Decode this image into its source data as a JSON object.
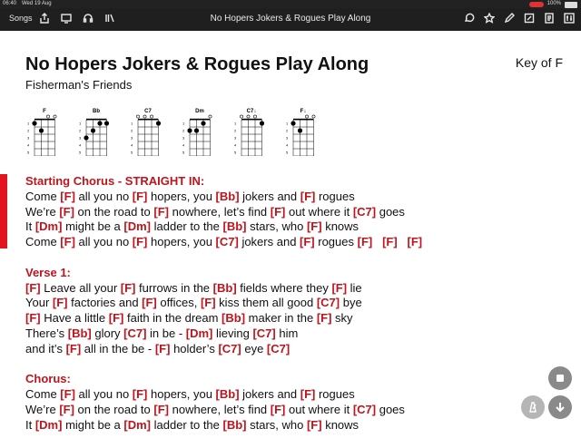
{
  "status_bar": {
    "time": "06:40",
    "date": "Wed 19 Aug",
    "battery": "100%"
  },
  "toolbar": {
    "songs_label": "Songs",
    "title": "No Hopers Jokers & Rogues Play Along"
  },
  "song": {
    "title": "No Hopers Jokers & Rogues Play Along",
    "artist": "Fisherman's Friends",
    "key": "Key of F"
  },
  "chord_diagrams": [
    {
      "name": "F",
      "markers": [
        "",
        "",
        "o",
        "o"
      ],
      "dots": [
        [
          1,
          0
        ],
        [
          2,
          1
        ]
      ]
    },
    {
      "name": "Bb",
      "markers": [
        "",
        "",
        "",
        ""
      ],
      "dots": [
        [
          1,
          2
        ],
        [
          1,
          3
        ],
        [
          2,
          1
        ],
        [
          3,
          0
        ]
      ]
    },
    {
      "name": "C7",
      "markers": [
        "o",
        "o",
        "o",
        ""
      ],
      "dots": [
        [
          1,
          3
        ]
      ]
    },
    {
      "name": "Dm",
      "markers": [
        "",
        "",
        "",
        "o"
      ],
      "dots": [
        [
          1,
          2
        ],
        [
          2,
          0
        ],
        [
          2,
          1
        ]
      ]
    },
    {
      "name": "C7↓",
      "markers": [
        "o",
        "o",
        "o",
        ""
      ],
      "dots": [
        [
          1,
          3
        ]
      ]
    },
    {
      "name": "F↓",
      "markers": [
        "",
        "",
        "o",
        "o"
      ],
      "dots": [
        [
          1,
          0
        ],
        [
          2,
          1
        ]
      ]
    }
  ],
  "sections": [
    {
      "title": "Starting Chorus - STRAIGHT IN:",
      "lines": [
        [
          [
            "",
            "Come "
          ],
          [
            "F",
            " all you no "
          ],
          [
            "F",
            " hopers, you "
          ],
          [
            "Bb",
            " jokers and "
          ],
          [
            "F",
            " rogues"
          ]
        ],
        [
          [
            "",
            "We’re "
          ],
          [
            "F",
            " on the road to "
          ],
          [
            "F",
            " nowhere, let’s find "
          ],
          [
            "F",
            " out where it "
          ],
          [
            "C7",
            " goes"
          ]
        ],
        [
          [
            "",
            "It "
          ],
          [
            "Dm",
            " might be a "
          ],
          [
            "Dm",
            " ladder to the "
          ],
          [
            "Bb",
            " stars, who "
          ],
          [
            "F",
            " knows"
          ]
        ],
        [
          [
            "",
            "Come "
          ],
          [
            "F",
            " all you no "
          ],
          [
            "F",
            " hopers, you "
          ],
          [
            "C7",
            " jokers and "
          ],
          [
            "F",
            " rogues "
          ],
          [
            "F",
            "   "
          ],
          [
            "F",
            "   "
          ],
          [
            "F",
            ""
          ]
        ]
      ]
    },
    {
      "title": "Verse 1:",
      "lines": [
        [
          [
            "F",
            " Leave all your "
          ],
          [
            "F",
            " furrows in the "
          ],
          [
            "Bb",
            " fields where they "
          ],
          [
            "F",
            " lie"
          ]
        ],
        [
          [
            "",
            "Your "
          ],
          [
            "F",
            " factories and "
          ],
          [
            "F",
            " offices, "
          ],
          [
            "F",
            " kiss them all good "
          ],
          [
            "C7",
            " bye"
          ]
        ],
        [
          [
            "F",
            " Have a little "
          ],
          [
            "F",
            " faith in the dream "
          ],
          [
            "Bb",
            " maker in the "
          ],
          [
            "F",
            " sky"
          ]
        ],
        [
          [
            "",
            "There’s "
          ],
          [
            "Bb",
            " glory "
          ],
          [
            "C7",
            " in be - "
          ],
          [
            "Dm",
            " lieving "
          ],
          [
            "C7",
            " him"
          ]
        ],
        [
          [
            "",
            "and it’s "
          ],
          [
            "F",
            " all in the be - "
          ],
          [
            "F",
            " holder’s "
          ],
          [
            "C7",
            " eye "
          ],
          [
            "C7",
            ""
          ]
        ]
      ]
    },
    {
      "title": "Chorus:",
      "lines": [
        [
          [
            "",
            "Come "
          ],
          [
            "F",
            " all you no "
          ],
          [
            "F",
            " hopers, you "
          ],
          [
            "Bb",
            " jokers and "
          ],
          [
            "F",
            " rogues"
          ]
        ],
        [
          [
            "",
            "We’re "
          ],
          [
            "F",
            " on the road to "
          ],
          [
            "F",
            " nowhere, let’s find "
          ],
          [
            "F",
            " out where it "
          ],
          [
            "C7",
            " goes"
          ]
        ],
        [
          [
            "",
            "It "
          ],
          [
            "Dm",
            " might be a "
          ],
          [
            "Dm",
            " ladder to the "
          ],
          [
            "Bb",
            " stars, who "
          ],
          [
            "F",
            " knows"
          ]
        ]
      ]
    }
  ],
  "icons": {
    "left": [
      "share-icon",
      "display-icon",
      "headphones-icon",
      "library-icon"
    ],
    "right": [
      "comment-icon",
      "star-icon",
      "pencil-icon",
      "note-edit-icon",
      "document-icon",
      "settings-sliders-icon"
    ]
  },
  "colors": {
    "chord": "#c0141c",
    "toolbar": "#1f1f1f",
    "accent_bar": "#e3141d"
  }
}
